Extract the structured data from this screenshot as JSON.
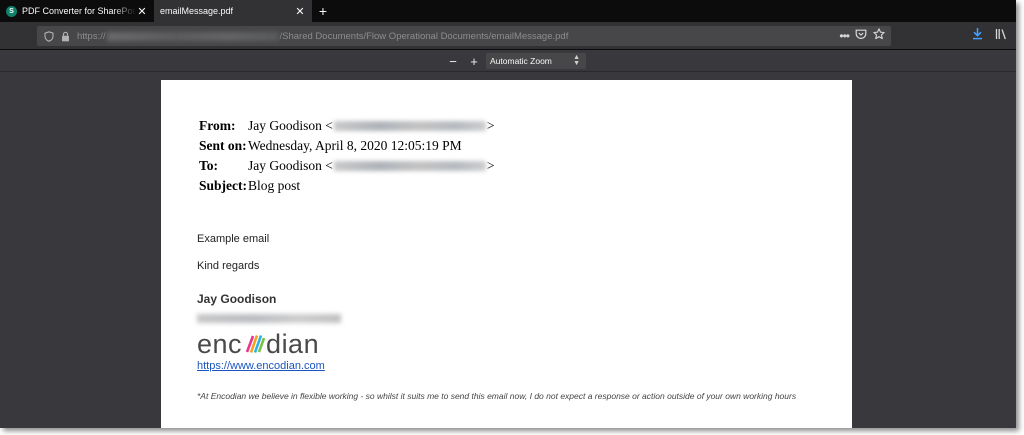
{
  "tabs": [
    {
      "title": "PDF Converter for SharePoint C",
      "favicon": "S",
      "active": false
    },
    {
      "title": "emailMessage.pdf",
      "active": true
    }
  ],
  "urlbar": {
    "scheme": "https://",
    "path": "/Shared Documents/Flow Operational Documents/emailMessage.pdf"
  },
  "pdf_toolbar": {
    "zoom_out": "−",
    "zoom_in": "+",
    "zoom_label": "Automatic Zoom"
  },
  "email": {
    "from_label": "From:",
    "from_name": "Jay Goodison <",
    "sent_label": "Sent on:",
    "sent_value": "Wednesday, April 8, 2020 12:05:19 PM",
    "to_label": "To:",
    "to_name": "Jay Goodison <",
    "subject_label": "Subject:",
    "subject_value": "Blog post",
    "closing_bracket": ">",
    "body_line1": "Example email",
    "body_line2": "Kind regards",
    "signature_name": "Jay Goodison",
    "logo_text_left": "enc",
    "logo_text_right": "dian",
    "website": "https://www.encodian.com",
    "footer": "*At Encodian we believe in flexible working - so whilst it suits me to send this email now, I do not expect a response or action outside of your own working hours"
  },
  "colors": {
    "accent_download": "#45a1ff",
    "link": "#1a55c2",
    "logo_stripes": [
      "#e8368f",
      "#f6a21d",
      "#2bb3e3",
      "#7ac143"
    ]
  }
}
